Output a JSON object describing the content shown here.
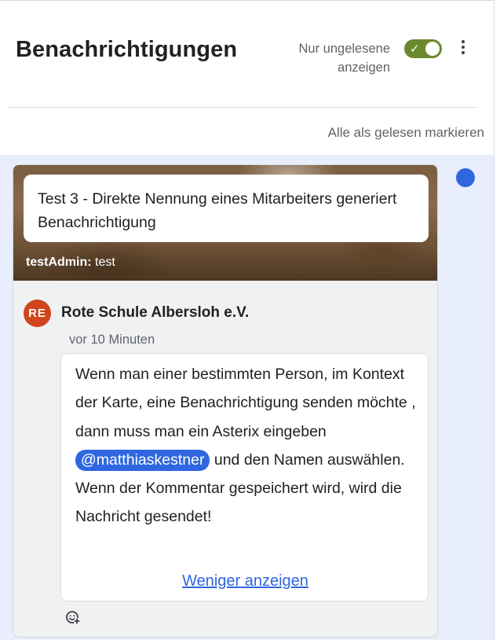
{
  "header": {
    "title": "Benachrichtigungen",
    "unread_toggle": {
      "label": "Nur ungelesene anzeigen",
      "checked": true,
      "on_color": "#6a8a2d"
    },
    "more_icon": "more-vertical-icon"
  },
  "actions": {
    "mark_all_read": "Alle als gelesen markieren"
  },
  "notifications": [
    {
      "unread": true,
      "unread_color": "#2f67e0",
      "card_title": "Test 3 - Direkte Nennung eines Mitarbeiters generiert Benachrichtigung",
      "card_meta_user": "testAdmin:",
      "card_meta_text": "test",
      "avatar_initials": "RE",
      "avatar_color": "#d0451b",
      "author": "Rote Schule Albersloh e.V.",
      "time": "vor 10 Minuten",
      "comment": {
        "before_mention": "Wenn man einer bestimmten Person, im Kontext der Karte, eine Benachrichtigung senden möchte , dann muss man ein Asterix eingeben ",
        "mention": "@matthiaskestner",
        "after_mention": " und den Namen auswählen. Wenn der Kommentar gespeichert wird, wird die Nachricht gesendet!"
      },
      "show_less": "Weniger anzeigen",
      "reaction_icon": "add-reaction-icon"
    }
  ]
}
